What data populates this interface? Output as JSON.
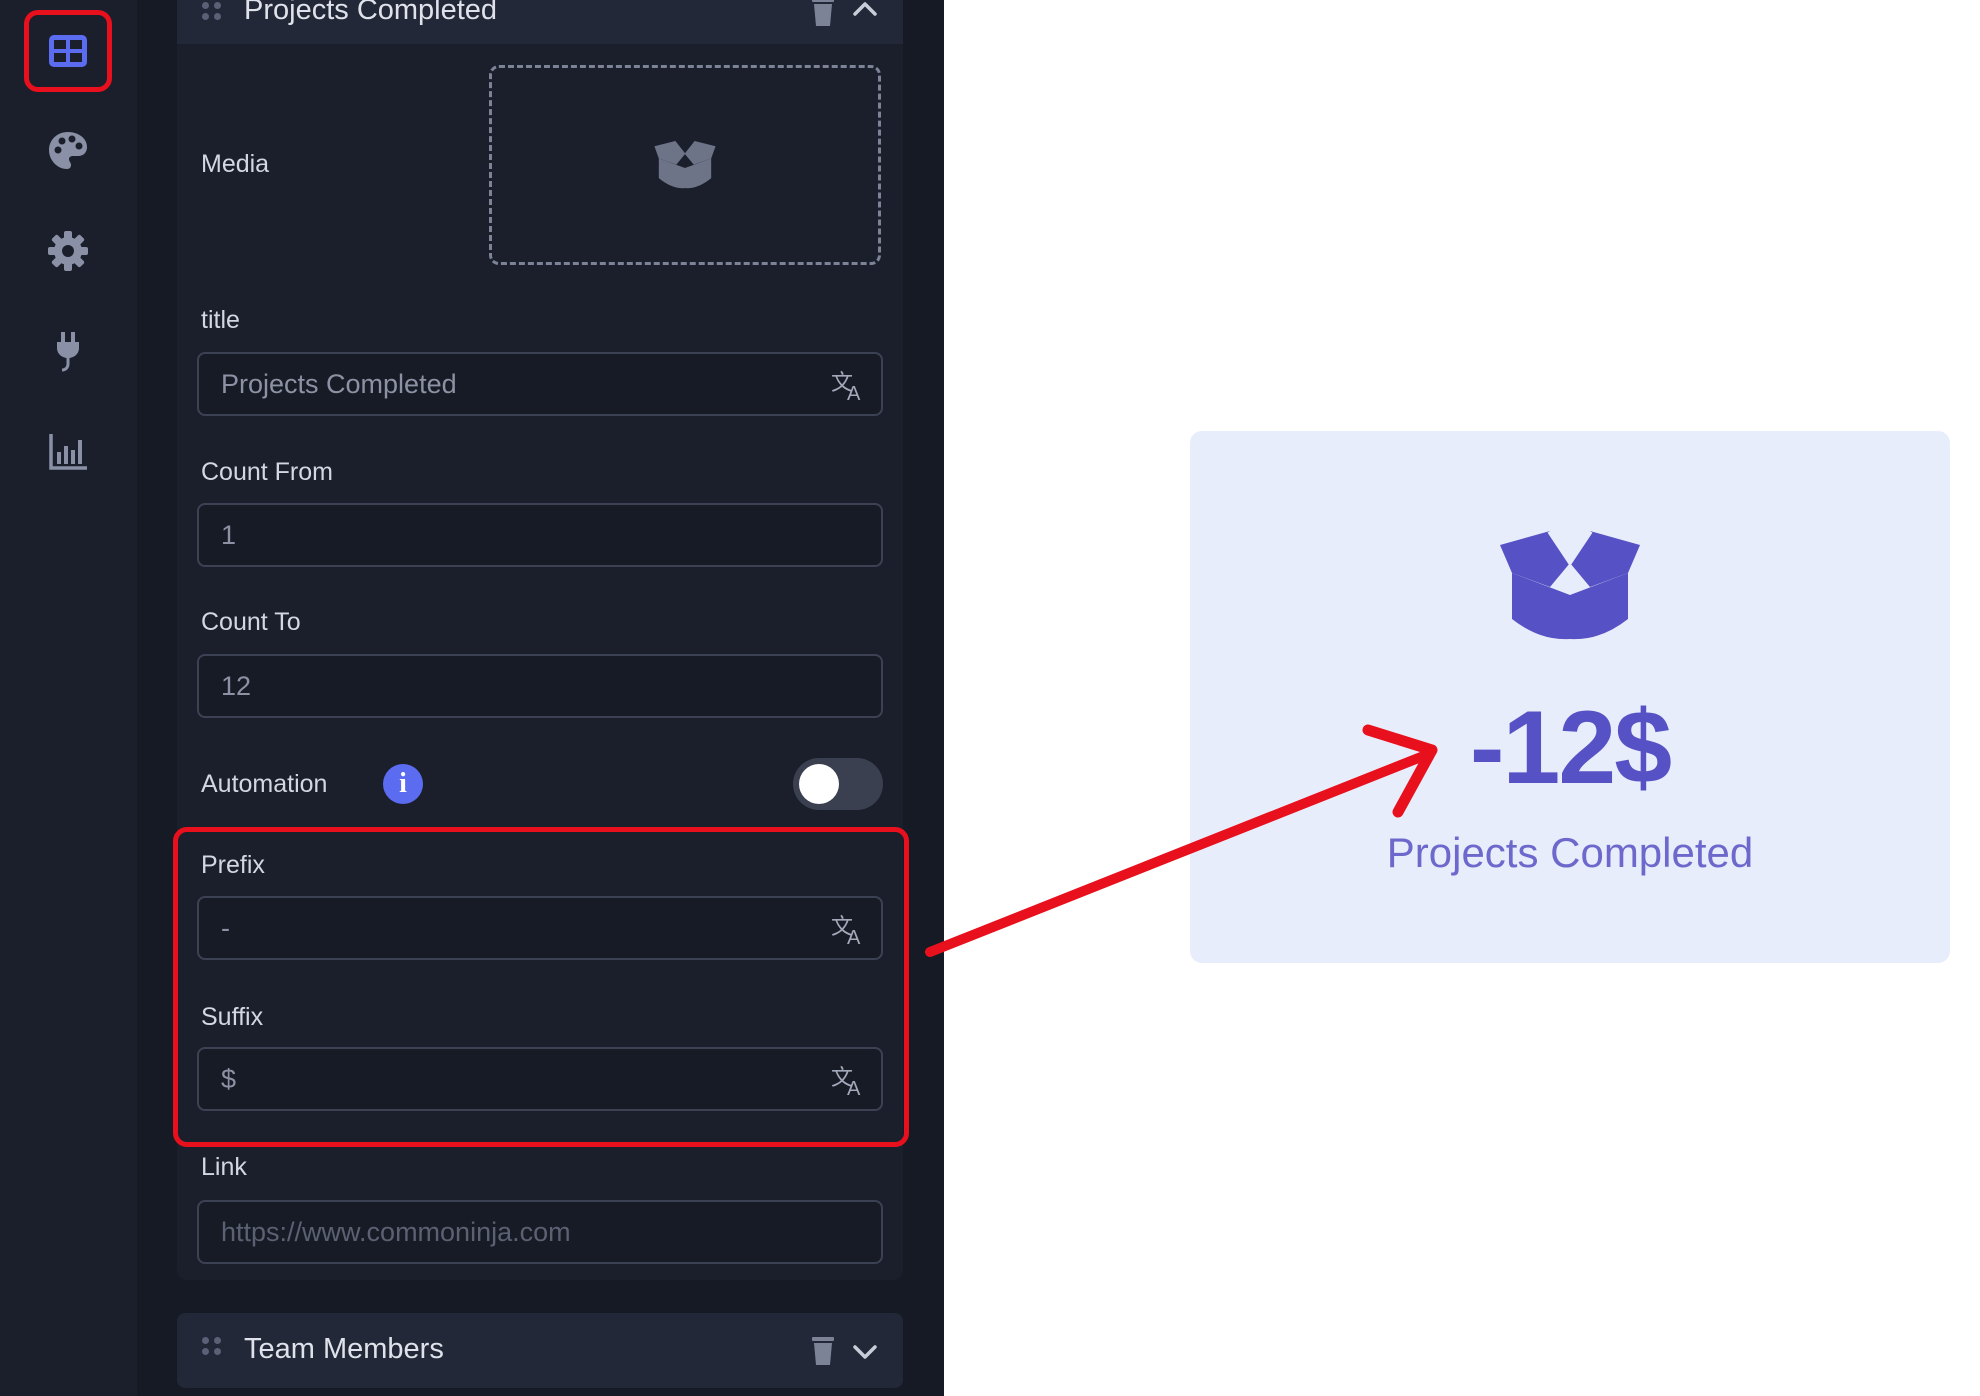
{
  "sidebar": {
    "items": [
      {
        "icon": "layout-grid-icon",
        "active": true
      },
      {
        "icon": "palette-icon",
        "active": false
      },
      {
        "icon": "gear-icon",
        "active": false
      },
      {
        "icon": "plug-icon",
        "active": false
      },
      {
        "icon": "analytics-chart-icon",
        "active": false
      }
    ]
  },
  "editor": {
    "card_title": "Projects Completed",
    "media_label": "Media",
    "title_label": "title",
    "title_value": "Projects Completed",
    "count_from_label": "Count From",
    "count_from_value": "1",
    "count_to_label": "Count To",
    "count_to_value": "12",
    "automation_label": "Automation",
    "automation_enabled": false,
    "info_glyph": "i",
    "prefix_label": "Prefix",
    "prefix_value": "-",
    "suffix_label": "Suffix",
    "suffix_value": "$",
    "link_label": "Link",
    "link_placeholder": "https://www.commoninja.com",
    "next_card_title": "Team Members"
  },
  "preview": {
    "value": "-12$",
    "title": "Projects Completed"
  },
  "colors": {
    "accent": "#5b6cf0",
    "highlight": "#e8101c",
    "preview_text": "#5652c6",
    "preview_bg": "#e8edfb"
  }
}
